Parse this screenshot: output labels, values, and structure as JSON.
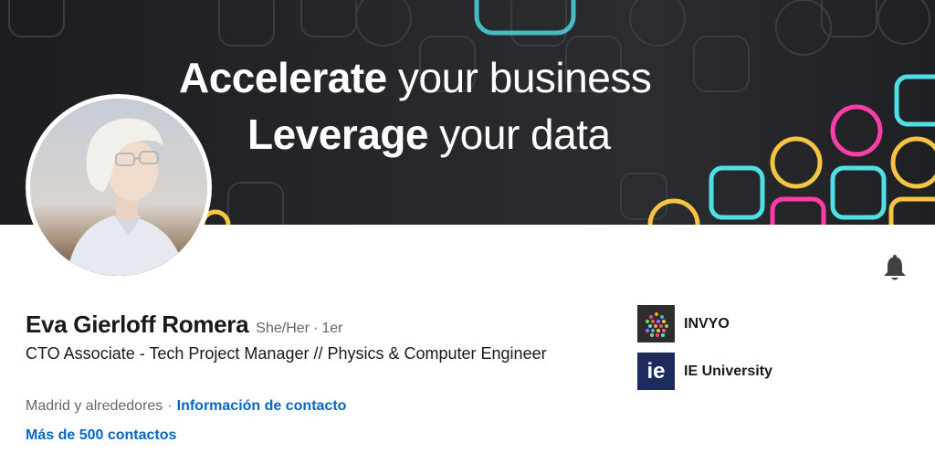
{
  "banner": {
    "line1_bold": "Accelerate",
    "line1_light": " your business",
    "line2_bold": "Leverage",
    "line2_light": " your data"
  },
  "profile": {
    "name": "Eva Gierloff Romera",
    "pronouns": "She/Her",
    "separator": "·",
    "degree": "1er",
    "headline": "CTO Associate - Tech Project Manager // Physics & Computer Engineer",
    "location": "Madrid y alrededores",
    "location_separator": "·",
    "contact_info_link": "Información de contacto",
    "connections_link": "Más de 500 contactos"
  },
  "organizations": [
    {
      "name": "INVYO",
      "logo_icon": "invyo-dots-logo"
    },
    {
      "name": "IE University",
      "logo_icon": "ie-logo",
      "logo_text": "ie"
    }
  ],
  "icons": {
    "notify": "bell-icon"
  },
  "colors": {
    "link": "#0a66c2",
    "text_primary": "#191919",
    "text_secondary": "#666666",
    "neon_yellow": "#f5c542",
    "neon_cyan": "#4fe0e6",
    "neon_pink": "#ff3da8"
  }
}
